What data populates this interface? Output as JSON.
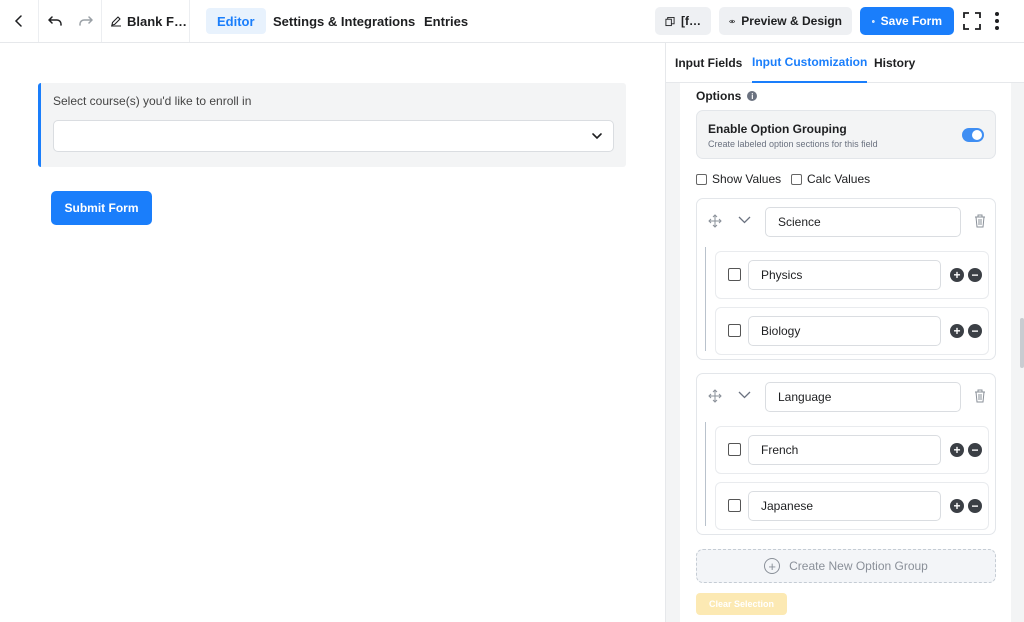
{
  "topbar": {
    "form_title": "Blank F…",
    "tabs": [
      {
        "label": "Editor",
        "active": true
      },
      {
        "label": "Settings & Integrations",
        "active": false
      },
      {
        "label": "Entries",
        "active": false
      }
    ],
    "shortcode_label": "[f…",
    "preview_label": "Preview & Design",
    "save_label": "Save Form",
    "accent_color": "#1a7efb"
  },
  "canvas": {
    "field_label": "Select course(s) you'd like to enroll in",
    "select_value": "",
    "submit_label": "Submit Form"
  },
  "panel": {
    "tabs": [
      {
        "label": "Input Fields",
        "active": false
      },
      {
        "label": "Input Customization",
        "active": true
      },
      {
        "label": "History",
        "active": false
      }
    ],
    "options_label": "Options",
    "grouping": {
      "title": "Enable Option Grouping",
      "description": "Create labeled option sections for this field",
      "enabled": true
    },
    "show_values_label": "Show Values",
    "calc_values_label": "Calc Values",
    "groups": [
      {
        "name": "Science",
        "options": [
          "Physics",
          "Biology"
        ]
      },
      {
        "name": "Language",
        "options": [
          "French",
          "Japanese"
        ]
      }
    ],
    "create_group_label": "Create New Option Group",
    "clear_selection_label": "Clear Selection"
  }
}
